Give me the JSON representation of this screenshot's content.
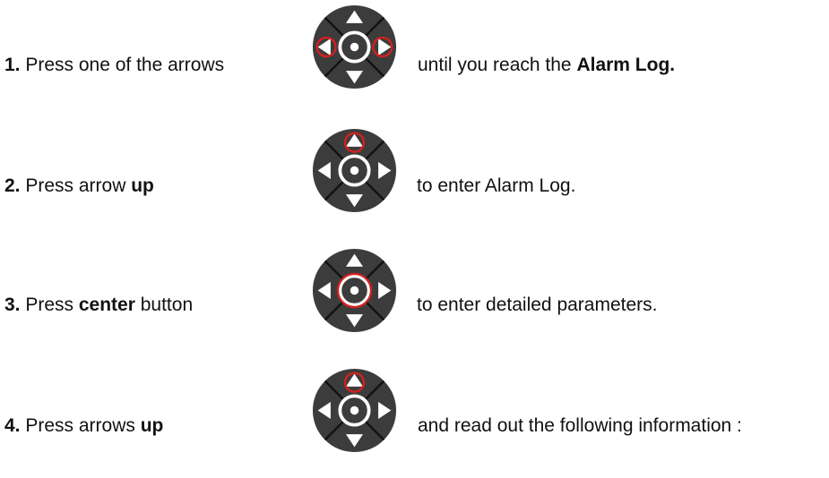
{
  "steps": [
    {
      "num": "1.",
      "pre": " Press one of the arrows",
      "post_plain": "until you reach the ",
      "post_bold": "Alarm Log.",
      "post_tail": "",
      "highlight": [
        "left",
        "right"
      ]
    },
    {
      "num": "2.",
      "pre": " Press arrow ",
      "pre_bold": "up",
      "pre_tail": "",
      "post_plain": "to enter Alarm Log.",
      "post_bold": "",
      "post_tail": "",
      "highlight": [
        "up"
      ]
    },
    {
      "num": "3.",
      "pre": " Press ",
      "pre_bold": "center",
      "pre_tail": " button",
      "post_plain": "to enter detailed parameters.",
      "post_bold": "",
      "post_tail": "",
      "highlight": [
        "center"
      ]
    },
    {
      "num": "4.",
      "pre": " Press arrows ",
      "pre_bold": "up",
      "pre_tail": "",
      "post_plain": "and read out the following information :",
      "post_bold": "",
      "post_tail": "",
      "highlight": [
        "up"
      ]
    }
  ],
  "colors": {
    "pad_body": "#3c3c3c",
    "pad_divider": "#111111",
    "arrow_fill": "#ffffff",
    "highlight": "#d42020"
  },
  "icons": [
    "navigation-pad-icon"
  ]
}
